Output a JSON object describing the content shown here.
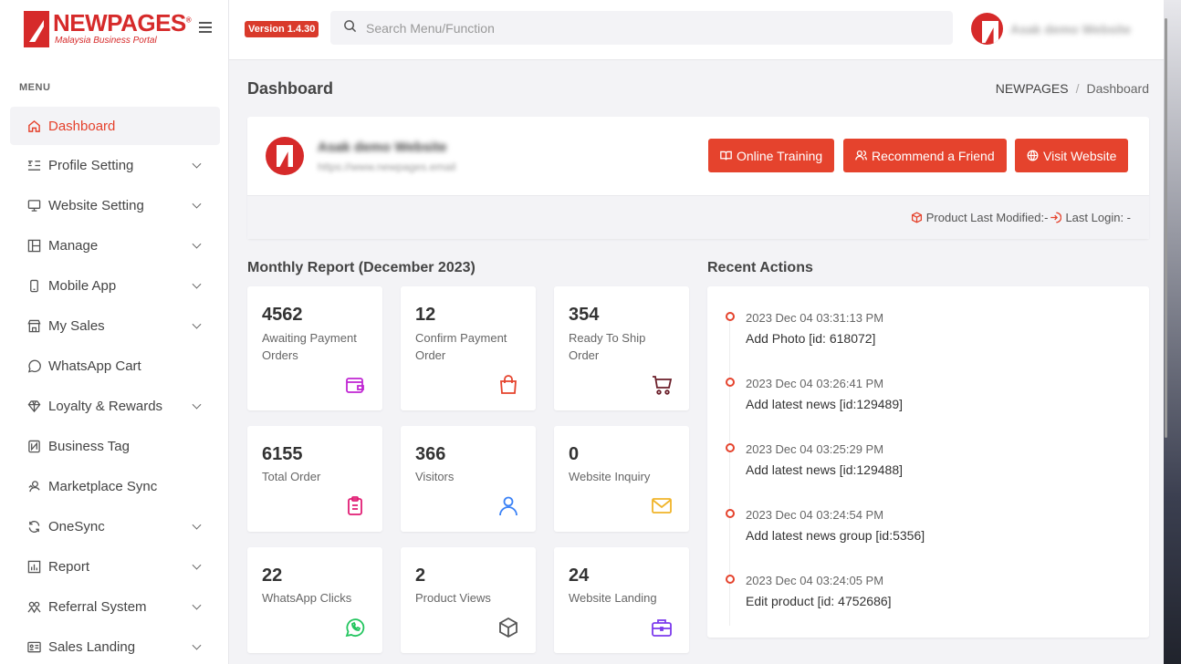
{
  "brand": {
    "name": "NEWPAGES",
    "registered": "®",
    "tagline": "Malaysia Business Portal"
  },
  "topbar": {
    "version": "Version 1.4.30",
    "search_placeholder": "Search Menu/Function",
    "user_name": "Asak demo Website"
  },
  "sidebar": {
    "menu_label": "MENU",
    "items": [
      {
        "label": "Dashboard",
        "icon": "home-icon",
        "active": true,
        "has_children": false
      },
      {
        "label": "Profile Setting",
        "icon": "list-settings-icon",
        "has_children": true
      },
      {
        "label": "Website Setting",
        "icon": "monitor-icon",
        "has_children": true
      },
      {
        "label": "Manage",
        "icon": "layout-icon",
        "has_children": true
      },
      {
        "label": "Mobile App",
        "icon": "mobile-icon",
        "has_children": true
      },
      {
        "label": "My Sales",
        "icon": "store-icon",
        "has_children": true
      },
      {
        "label": "WhatsApp Cart",
        "icon": "whatsapp-icon",
        "has_children": false
      },
      {
        "label": "Loyalty & Rewards",
        "icon": "diamond-icon",
        "has_children": true
      },
      {
        "label": "Business Tag",
        "icon": "nfc-icon",
        "has_children": false
      },
      {
        "label": "Marketplace Sync",
        "icon": "users-sync-icon",
        "has_children": false
      },
      {
        "label": "OneSync",
        "icon": "refresh-icon",
        "has_children": true
      },
      {
        "label": "Report",
        "icon": "report-icon",
        "has_children": true
      },
      {
        "label": "Referral System",
        "icon": "referral-icon",
        "has_children": true
      },
      {
        "label": "Sales Landing",
        "icon": "id-card-icon",
        "has_children": true
      }
    ]
  },
  "page": {
    "title": "Dashboard",
    "breadcrumb": [
      "NEWPAGES",
      "Dashboard"
    ]
  },
  "profile": {
    "site_name": "Asak demo Website",
    "site_url": "https://www.newpages.email",
    "buttons": {
      "training": "Online Training",
      "recommend": "Recommend a Friend",
      "visit": "Visit Website"
    },
    "product_modified": "Product Last Modified:-",
    "last_login": "Last Login: -"
  },
  "monthly": {
    "title": "Monthly Report (December 2023)",
    "stats": [
      {
        "value": "4562",
        "label": "Awaiting Payment Orders",
        "icon": "wallet-icon",
        "color": "#c026d3"
      },
      {
        "value": "12",
        "label": "Confirm Payment Order",
        "icon": "shopping-bag-icon",
        "color": "#e5432d"
      },
      {
        "value": "354",
        "label": "Ready To Ship Order",
        "icon": "cart-icon",
        "color": "#6b1f2a"
      },
      {
        "value": "6155",
        "label": "Total Order",
        "icon": "clipboard-icon",
        "color": "#e11d74"
      },
      {
        "value": "366",
        "label": "Visitors",
        "icon": "user-icon",
        "color": "#3b82f6"
      },
      {
        "value": "0",
        "label": "Website Inquiry",
        "icon": "mail-icon",
        "color": "#f0b429"
      },
      {
        "value": "22",
        "label": "WhatsApp Clicks",
        "icon": "whatsapp-icon",
        "color": "#22c55e"
      },
      {
        "value": "2",
        "label": "Product Views",
        "icon": "box-icon",
        "color": "#555555"
      },
      {
        "value": "24",
        "label": "Website Landing",
        "icon": "briefcase-icon",
        "color": "#7c3aed"
      }
    ]
  },
  "recent": {
    "title": "Recent Actions",
    "items": [
      {
        "time": "2023 Dec 04 03:31:13 PM",
        "text": "Add Photo [id: 618072]"
      },
      {
        "time": "2023 Dec 04 03:26:41 PM",
        "text": "Add latest news [id:129489]"
      },
      {
        "time": "2023 Dec 04 03:25:29 PM",
        "text": "Add latest news [id:129488]"
      },
      {
        "time": "2023 Dec 04 03:24:54 PM",
        "text": "Add latest news group [id:5356]"
      },
      {
        "time": "2023 Dec 04 03:24:05 PM",
        "text": "Edit product [id: 4752686]"
      }
    ]
  }
}
